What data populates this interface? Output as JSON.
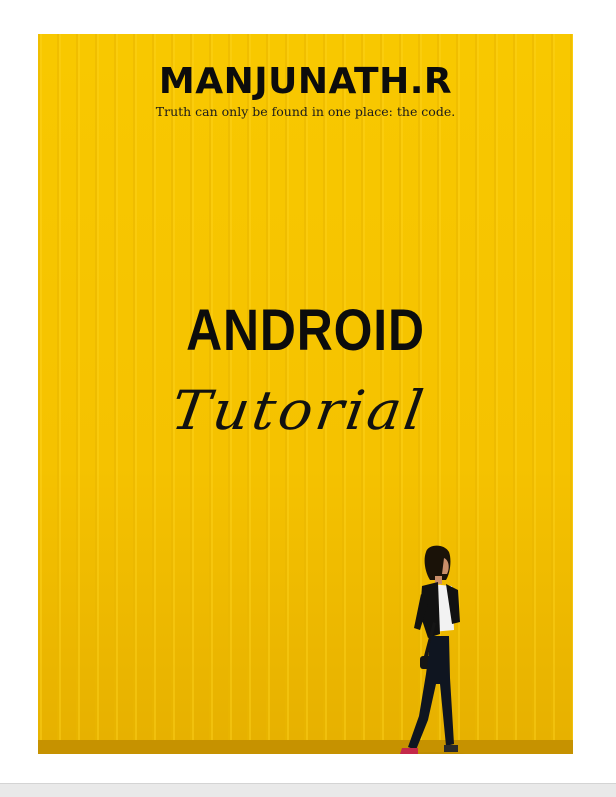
{
  "cover": {
    "author": "MANJUNATH.R",
    "tagline": "Truth can only be found in one place: the code.",
    "title": "ANDROID",
    "subtitle": "Tutorial"
  },
  "colors": {
    "background": "#f6c400",
    "text": "#0c0c0c"
  }
}
